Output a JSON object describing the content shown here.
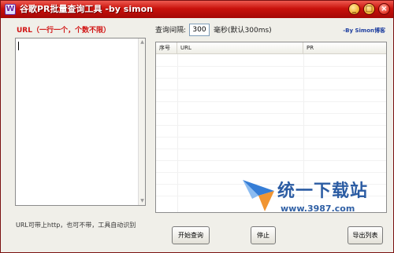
{
  "window": {
    "title": "谷歌PR批量查询工具 -by simon",
    "icon_letter": "W",
    "controls": {
      "minimize": "_",
      "maximize": "□",
      "close": "×"
    }
  },
  "left_panel": {
    "url_label": "URL（一行一个，个数不限）",
    "url_value": "",
    "hint": "URL可带上http，也可不带，工具自动识别"
  },
  "interval": {
    "label": "查询间隔:",
    "value": "300",
    "unit": "毫秒(默认300ms)"
  },
  "blog_link": "-By Simon博客",
  "table": {
    "columns": [
      "序号",
      "URL",
      "PR"
    ],
    "rows": []
  },
  "buttons": {
    "start": "开始查询",
    "stop": "停止",
    "export": "导出列表"
  },
  "watermark": {
    "title": "统一下载站",
    "url": "www.3987.com"
  },
  "colors": {
    "titlebar": "#c8120c",
    "url_label": "#d11414",
    "blog_link": "#2040a0",
    "watermark": "#1a4f9c"
  }
}
